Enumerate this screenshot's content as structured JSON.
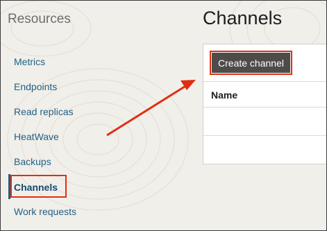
{
  "sidebar": {
    "title": "Resources",
    "items": [
      {
        "label": "Metrics"
      },
      {
        "label": "Endpoints"
      },
      {
        "label": "Read replicas"
      },
      {
        "label": "HeatWave"
      },
      {
        "label": "Backups"
      },
      {
        "label": "Channels"
      },
      {
        "label": "Work requests"
      }
    ]
  },
  "main": {
    "title": "Channels",
    "create_button_label": "Create channel",
    "table": {
      "columns": [
        "Name"
      ]
    }
  },
  "colors": {
    "link": "#1f5f87",
    "highlight": "#e02d12",
    "button_bg": "#4e4b48",
    "background": "#f1efe9"
  }
}
